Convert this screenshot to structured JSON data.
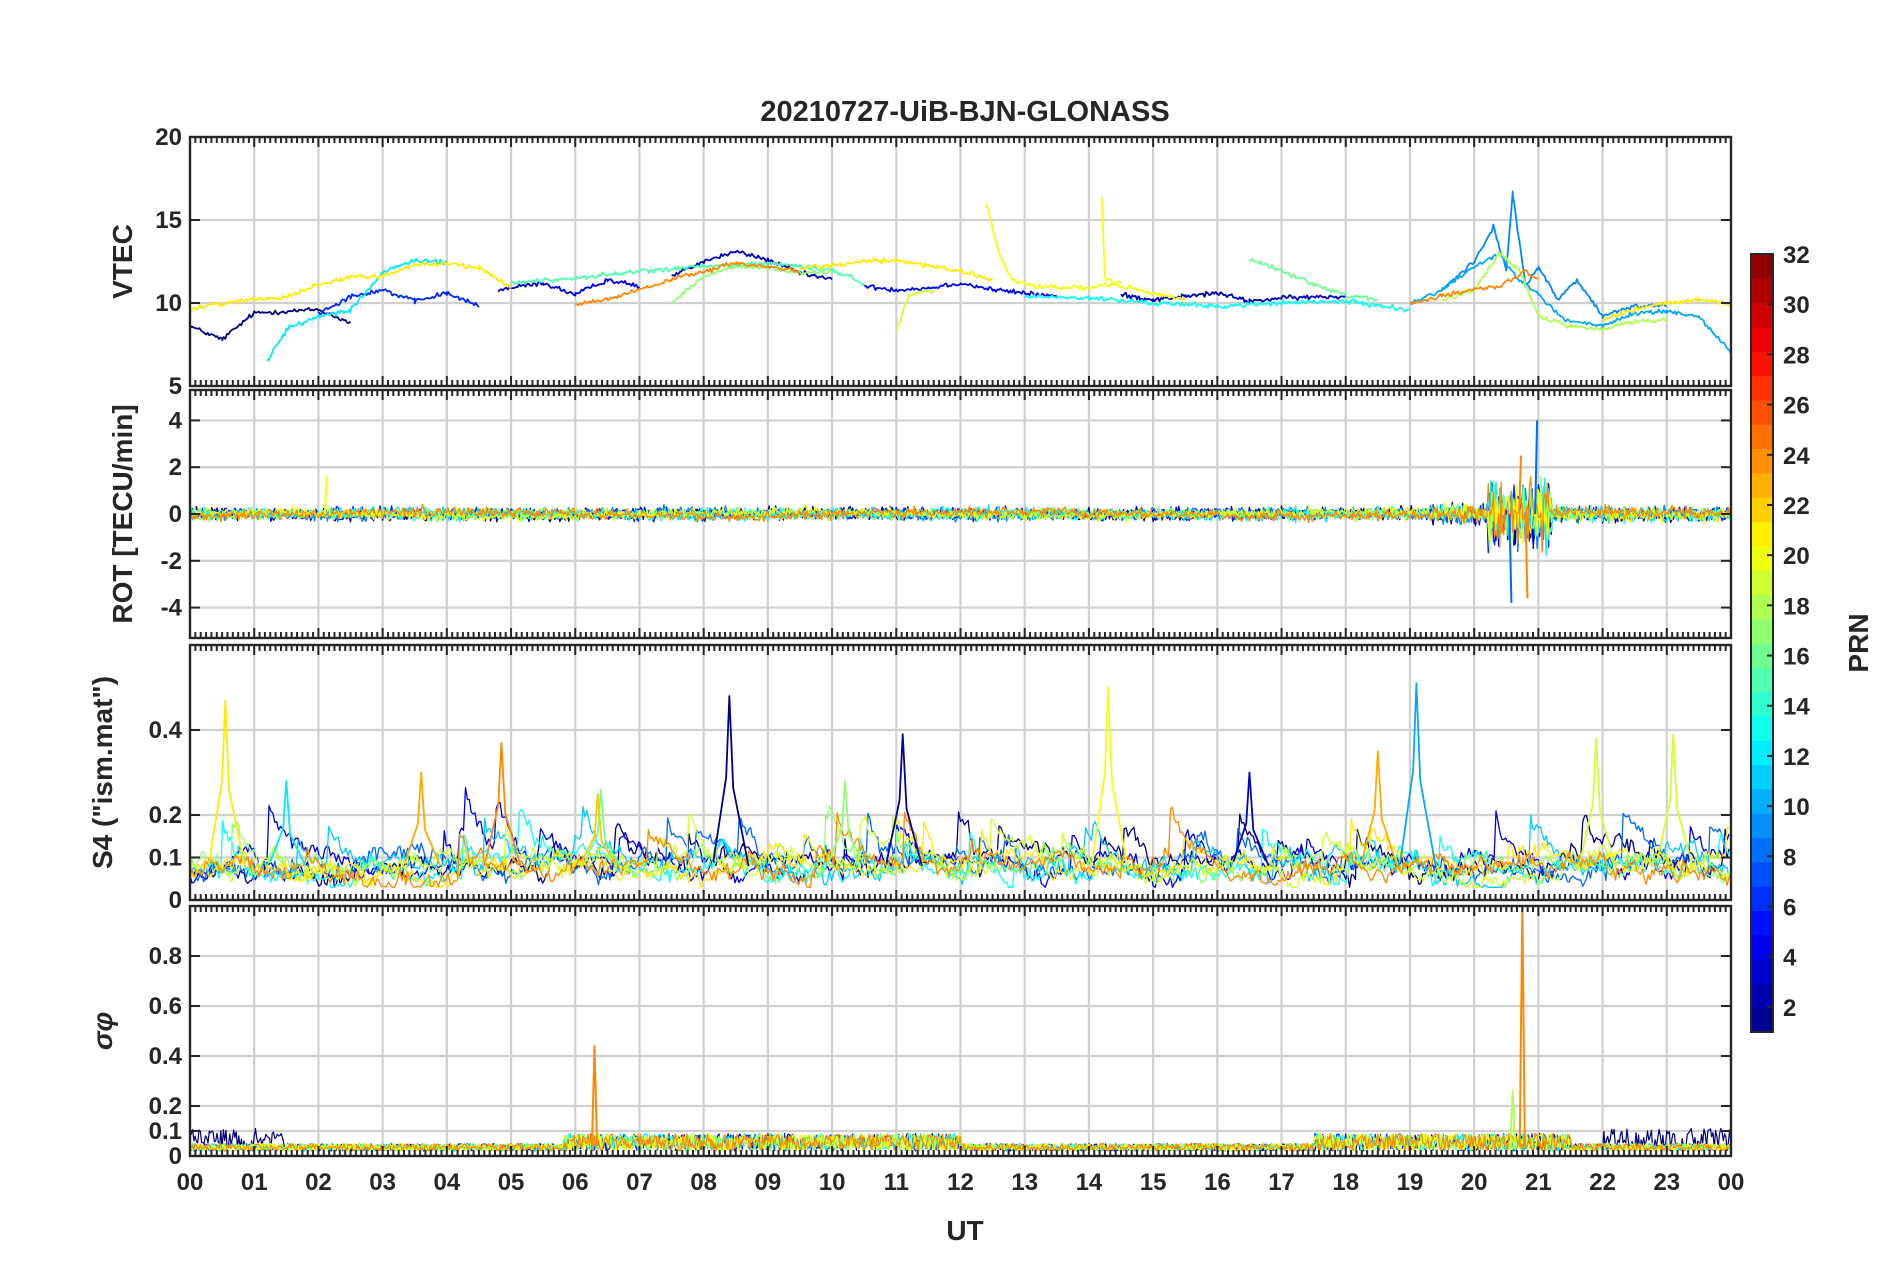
{
  "chart_data": {
    "type": "line",
    "title": "20210727-UiB-BJN-GLONASS",
    "xlabel": "UT",
    "x_tick_labels": [
      "00",
      "01",
      "02",
      "03",
      "04",
      "05",
      "06",
      "07",
      "08",
      "09",
      "10",
      "11",
      "12",
      "13",
      "14",
      "15",
      "16",
      "17",
      "18",
      "19",
      "20",
      "21",
      "22",
      "23",
      "00"
    ],
    "xlim": [
      0,
      24
    ],
    "grid": true,
    "colorbar": {
      "label": "PRN",
      "range": [
        1,
        32
      ],
      "tick_labels": [
        "2",
        "4",
        "6",
        "8",
        "10",
        "12",
        "14",
        "16",
        "18",
        "20",
        "22",
        "24",
        "26",
        "28",
        "30",
        "32"
      ],
      "colormap": "jet"
    },
    "panels": [
      {
        "id": "vtec",
        "ylabel": "VTEC",
        "ylim": [
          5,
          20
        ],
        "yticks": [
          5,
          10,
          15,
          20
        ],
        "series": [
          {
            "prn": 1,
            "points": [
              [
                0,
                8.6
              ],
              [
                0.5,
                7.8
              ],
              [
                1,
                9.4
              ],
              [
                2,
                9.6
              ],
              [
                2.5,
                8.8
              ]
            ]
          },
          {
            "prn": 3,
            "points": [
              [
                7.5,
                11.6
              ],
              [
                8,
                12.5
              ],
              [
                8.5,
                13.1
              ],
              [
                9,
                12.6
              ],
              [
                9.5,
                11.8
              ],
              [
                10,
                11.4
              ]
            ]
          },
          {
            "prn": 4,
            "points": [
              [
                4.8,
                10.8
              ],
              [
                5.5,
                11.2
              ],
              [
                6,
                10.5
              ],
              [
                6.5,
                11.4
              ],
              [
                7,
                11.0
              ]
            ]
          },
          {
            "prn": 5,
            "points": [
              [
                10.5,
                11.0
              ],
              [
                11,
                10.8
              ],
              [
                11.5,
                10.9
              ],
              [
                12,
                11.2
              ],
              [
                12.5,
                10.8
              ],
              [
                13,
                10.6
              ],
              [
                13.5,
                10.4
              ]
            ]
          },
          {
            "prn": 3,
            "points": [
              [
                14.5,
                10.5
              ],
              [
                15,
                10.2
              ],
              [
                15.5,
                10.4
              ],
              [
                16,
                10.6
              ],
              [
                16.5,
                10.1
              ],
              [
                17,
                10.3
              ],
              [
                18,
                10.4
              ]
            ]
          },
          {
            "prn": 6,
            "points": [
              [
                2,
                9.4
              ],
              [
                2.5,
                10.4
              ],
              [
                3,
                10.8
              ],
              [
                3.5,
                10.1
              ],
              [
                4,
                10.6
              ],
              [
                4.5,
                9.8
              ]
            ]
          },
          {
            "prn": 9,
            "points": [
              [
                19.5,
                10.8
              ],
              [
                20,
                12.5
              ],
              [
                20.3,
                14.6
              ],
              [
                20.5,
                12.0
              ],
              [
                20.6,
                16.6
              ],
              [
                20.8,
                11.0
              ],
              [
                21,
                12.2
              ],
              [
                21.3,
                10.2
              ],
              [
                21.6,
                11.4
              ],
              [
                22,
                9.2
              ],
              [
                22.5,
                9.8
              ],
              [
                23,
                9.9
              ]
            ]
          },
          {
            "prn": 10,
            "points": [
              [
                19,
                10.0
              ],
              [
                19.5,
                10.8
              ],
              [
                20,
                12.2
              ],
              [
                20.4,
                13.0
              ],
              [
                20.7,
                11.4
              ],
              [
                21,
                10.5
              ],
              [
                21.4,
                9.0
              ],
              [
                22,
                8.6
              ],
              [
                22.5,
                9.4
              ],
              [
                23,
                9.5
              ],
              [
                23.5,
                9.2
              ],
              [
                24,
                7.0
              ]
            ]
          },
          {
            "prn": 12,
            "points": [
              [
                1.2,
                6.5
              ],
              [
                1.5,
                8.4
              ],
              [
                2,
                9.2
              ],
              [
                2.5,
                9.6
              ],
              [
                3,
                11.8
              ],
              [
                3.5,
                12.6
              ],
              [
                4,
                12.4
              ]
            ]
          },
          {
            "prn": 13,
            "points": [
              [
                13,
                10.4
              ],
              [
                14,
                10.3
              ],
              [
                15,
                10.0
              ],
              [
                16,
                9.8
              ],
              [
                17,
                10.0
              ],
              [
                18,
                10.1
              ],
              [
                19,
                9.6
              ]
            ]
          },
          {
            "prn": 15,
            "points": [
              [
                5,
                11.2
              ],
              [
                6,
                11.5
              ],
              [
                7,
                11.9
              ],
              [
                8,
                12.2
              ],
              [
                9,
                12.4
              ],
              [
                10,
                12.0
              ],
              [
                10.5,
                11.2
              ]
            ]
          },
          {
            "prn": 16,
            "points": [
              [
                16.5,
                12.6
              ],
              [
                17,
                12.0
              ],
              [
                17.5,
                11.1
              ],
              [
                18,
                10.5
              ],
              [
                18.5,
                10.2
              ]
            ]
          },
          {
            "prn": 17,
            "points": [
              [
                7.5,
                10.0
              ],
              [
                8,
                11.6
              ],
              [
                8.5,
                12.2
              ],
              [
                9,
                12.1
              ],
              [
                9.5,
                11.8
              ],
              [
                10,
                11.9
              ]
            ]
          },
          {
            "prn": 18,
            "points": [
              [
                19.5,
                10.2
              ],
              [
                20,
                10.8
              ],
              [
                20.4,
                13.0
              ],
              [
                20.7,
                12.0
              ],
              [
                21,
                9.2
              ],
              [
                21.5,
                8.6
              ],
              [
                22,
                8.4
              ],
              [
                22.5,
                8.9
              ],
              [
                23,
                9.0
              ]
            ]
          },
          {
            "prn": 19,
            "points": [
              [
                11,
                8.3
              ],
              [
                11.2,
                10.5
              ],
              [
                11.6,
                10.8
              ]
            ]
          },
          {
            "prn": 20,
            "points": [
              [
                12.4,
                16.0
              ],
              [
                12.6,
                13.0
              ],
              [
                12.8,
                11.4
              ],
              [
                13.2,
                11.0
              ],
              [
                14,
                10.9
              ],
              [
                14.5,
                11.2
              ]
            ]
          },
          {
            "prn": 20,
            "points": [
              [
                14.2,
                16.4
              ],
              [
                14.25,
                11.5
              ],
              [
                14.5,
                11.0
              ],
              [
                15,
                10.6
              ],
              [
                15.5,
                10.2
              ]
            ]
          },
          {
            "prn": 21,
            "points": [
              [
                0,
                9.6
              ],
              [
                0.5,
                10.0
              ],
              [
                1,
                10.2
              ],
              [
                1.5,
                10.4
              ],
              [
                2,
                11.1
              ],
              [
                2.5,
                11.6
              ],
              [
                3,
                11.6
              ],
              [
                3.5,
                12.3
              ],
              [
                4,
                12.4
              ],
              [
                4.5,
                12.1
              ],
              [
                5,
                11.0
              ]
            ]
          },
          {
            "prn": 21,
            "points": [
              [
                9.5,
                12.1
              ],
              [
                10,
                12.3
              ],
              [
                10.5,
                12.5
              ],
              [
                11,
                12.6
              ],
              [
                11.5,
                12.2
              ],
              [
                12,
                11.9
              ],
              [
                12.5,
                11.4
              ]
            ]
          },
          {
            "prn": 21,
            "points": [
              [
                22,
                9.0
              ],
              [
                22.5,
                9.6
              ],
              [
                23,
                10.0
              ],
              [
                23.5,
                10.2
              ],
              [
                24,
                10.0
              ]
            ]
          },
          {
            "prn": 24,
            "points": [
              [
                6,
                9.9
              ],
              [
                6.5,
                10.2
              ],
              [
                7,
                10.8
              ],
              [
                7.5,
                11.4
              ],
              [
                8,
                11.9
              ],
              [
                8.5,
                12.4
              ],
              [
                9,
                12.2
              ],
              [
                9.5,
                11.9
              ]
            ]
          },
          {
            "prn": 24,
            "points": [
              [
                19,
                10.0
              ],
              [
                19.5,
                10.4
              ],
              [
                20,
                10.8
              ],
              [
                20.4,
                11.0
              ],
              [
                20.8,
                11.9
              ],
              [
                21,
                11.4
              ]
            ]
          }
        ]
      },
      {
        "id": "rot",
        "ylabel": "ROT [TECU/min]",
        "ylim": [
          -5.3,
          5.3
        ],
        "yticks": [
          -4,
          -2,
          0,
          2,
          4
        ],
        "ytick_labels": [
          "-4",
          "-2",
          "0",
          "2",
          "4"
        ],
        "noise_model": [
          {
            "x_range": [
              0,
              19.3
            ],
            "amplitude": 0.35
          },
          {
            "x_range": [
              19.3,
              20.2
            ],
            "amplitude": 0.6
          },
          {
            "x_range": [
              20.2,
              21.2
            ],
            "amplitude": 2.2
          },
          {
            "x_range": [
              21.2,
              24
            ],
            "amplitude": 0.45
          }
        ],
        "extremes": [
          {
            "prn": 8,
            "x": 20.95,
            "y": 4.0
          },
          {
            "prn": 8,
            "x": 20.55,
            "y": -3.8
          },
          {
            "prn": 24,
            "x": 20.7,
            "y": 2.5
          },
          {
            "prn": 24,
            "x": 20.8,
            "y": -3.6
          },
          {
            "prn": 20,
            "x": 2.1,
            "y": 1.6
          }
        ]
      },
      {
        "id": "s4",
        "ylabel": "S4 (\"ism.mat\")",
        "ylim": [
          0,
          0.6
        ],
        "yticks": [
          0,
          0.1,
          0.2,
          0.4
        ],
        "ytick_labels": [
          "0",
          "0.1",
          "0.2",
          "0.4"
        ],
        "baseline": 0.06,
        "peaks": [
          {
            "prn": 21,
            "x": 0.55,
            "y": 0.47
          },
          {
            "prn": 24,
            "x": 4.85,
            "y": 0.37
          },
          {
            "prn": 1,
            "x": 8.4,
            "y": 0.48
          },
          {
            "prn": 2,
            "x": 11.1,
            "y": 0.39
          },
          {
            "prn": 20,
            "x": 14.3,
            "y": 0.5
          },
          {
            "prn": 10,
            "x": 19.1,
            "y": 0.51
          },
          {
            "prn": 23,
            "x": 18.5,
            "y": 0.35
          },
          {
            "prn": 19,
            "x": 23.1,
            "y": 0.39
          },
          {
            "prn": 19,
            "x": 21.9,
            "y": 0.38
          },
          {
            "prn": 12,
            "x": 1.5,
            "y": 0.28
          },
          {
            "prn": 23,
            "x": 3.6,
            "y": 0.3
          },
          {
            "prn": 16,
            "x": 6.4,
            "y": 0.26
          },
          {
            "prn": 17,
            "x": 10.2,
            "y": 0.28
          },
          {
            "prn": 3,
            "x": 16.5,
            "y": 0.3
          },
          {
            "prn": 22,
            "x": 6.35,
            "y": 0.25
          }
        ]
      },
      {
        "id": "sigma_phi",
        "ylabel": "σφ",
        "ylim": [
          0,
          1
        ],
        "yticks": [
          0,
          0.1,
          0.2,
          0.4,
          0.6,
          0.8
        ],
        "ytick_labels": [
          "0",
          "0.1",
          "0.2",
          "0.4",
          "0.6",
          "0.8"
        ],
        "baseline": 0.05,
        "peaks": [
          {
            "prn": 24,
            "x": 6.3,
            "y": 0.44
          },
          {
            "prn": 24,
            "x": 20.75,
            "y": 1.0
          },
          {
            "prn": 18,
            "x": 20.6,
            "y": 0.26
          }
        ]
      }
    ]
  }
}
